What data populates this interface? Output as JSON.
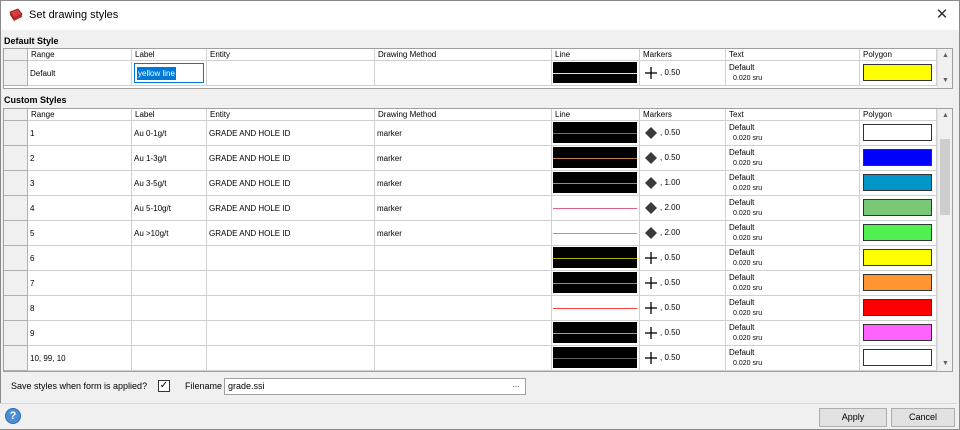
{
  "window": {
    "title": "Set drawing styles",
    "close_glyph": "✕"
  },
  "default_section": {
    "title": "Default Style"
  },
  "custom_section": {
    "title": "Custom Styles"
  },
  "columns": {
    "range": "Range",
    "label": "Label",
    "entity": "Entity",
    "drawing_method": "Drawing Method",
    "line": "Line",
    "markers": "Markers",
    "text": "Text",
    "polygon": "Polygon"
  },
  "default_row": {
    "range": "Default",
    "label": "yellow line",
    "entity": "",
    "method": "",
    "line_bg": "#000000",
    "line_color": "#ffff00",
    "marker": "cross-icon",
    "marker_size": ", 0.50",
    "text_font": "Default",
    "text_size": "0.020 sru",
    "polygon_color": "#ffff00"
  },
  "custom_rows": [
    {
      "range": "1",
      "label": "Au 0-1g/t",
      "entity": "GRADE AND HOLE ID",
      "method": "marker",
      "line_bg": "#000000",
      "line_color": "#00b050",
      "marker": "diamond-icon",
      "marker_size": ", 0.50",
      "text_font": "Default",
      "text_size": "0.020 sru",
      "polygon_color": "#ffffff"
    },
    {
      "range": "2",
      "label": "Au 1-3g/t",
      "entity": "GRADE AND HOLE ID",
      "method": "marker",
      "line_bg": "#000000",
      "line_color": "#c0804a",
      "marker": "diamond-icon",
      "marker_size": ", 0.50",
      "text_font": "Default",
      "text_size": "0.020 sru",
      "polygon_color": "#0000ff"
    },
    {
      "range": "3",
      "label": "Au 3-5g/t",
      "entity": "GRADE AND HOLE ID",
      "method": "marker",
      "line_bg": "#000000",
      "line_color": "#c0804a",
      "marker": "diamond-icon",
      "marker_size": ", 1.00",
      "text_font": "Default",
      "text_size": "0.020 sru",
      "polygon_color": "#0096c8"
    },
    {
      "range": "4",
      "label": "Au 5-10g/t",
      "entity": "GRADE AND HOLE ID",
      "method": "marker",
      "line_bg": "#ffffff",
      "line_color": "#e0608a",
      "marker": "diamond-icon",
      "marker_size": ", 2.00",
      "text_font": "Default",
      "text_size": "0.020 sru",
      "polygon_color": "#78c878"
    },
    {
      "range": "5",
      "label": "Au >10g/t",
      "entity": "GRADE AND HOLE ID",
      "method": "marker",
      "line_bg": "#ffffff",
      "line_color": "#e070d0",
      "marker": "diamond-icon",
      "marker_size": ", 2.00",
      "text_font": "Default",
      "text_size": "0.020 sru",
      "polygon_color": "#50f050"
    },
    {
      "range": "6",
      "label": "",
      "entity": "",
      "method": "",
      "line_bg": "#000000",
      "line_color": "#b0b000",
      "marker": "cross-icon",
      "marker_size": ", 0.50",
      "text_font": "Default",
      "text_size": "0.020 sru",
      "polygon_color": "#ffff00"
    },
    {
      "range": "7",
      "label": "",
      "entity": "",
      "method": "",
      "line_bg": "#000000",
      "line_color": "#c0804a",
      "marker": "cross-icon",
      "marker_size": ", 0.50",
      "text_font": "Default",
      "text_size": "0.020 sru",
      "polygon_color": "#ff9632"
    },
    {
      "range": "8",
      "label": "",
      "entity": "",
      "method": "",
      "line_bg": "#ffffff",
      "line_color": "#ff4040",
      "marker": "cross-icon",
      "marker_size": ", 0.50",
      "text_font": "Default",
      "text_size": "0.020 sru",
      "polygon_color": "#ff0000"
    },
    {
      "range": "9",
      "label": "",
      "entity": "",
      "method": "",
      "line_bg": "#000000",
      "line_color": "#e070d0",
      "marker": "cross-icon",
      "marker_size": ", 0.50",
      "text_font": "Default",
      "text_size": "0.020 sru",
      "polygon_color": "#ff64ff"
    },
    {
      "range": "10, 99, 10",
      "label": "",
      "entity": "",
      "method": "",
      "line_bg": "#000000",
      "line_color": "#606060",
      "marker": "cross-icon",
      "marker_size": ", 0.50",
      "text_font": "Default",
      "text_size": "0.020 sru",
      "polygon_color": "#ffffff"
    }
  ],
  "footer": {
    "save_label": "Save styles when form is applied?",
    "save_checked": "✓",
    "filename_label": "Filename",
    "filename_value": "grade.ssi",
    "browse_label": "..."
  },
  "buttons": {
    "help": "?",
    "apply": "Apply",
    "cancel": "Cancel"
  },
  "scrollbar": {
    "up_arrow": "▲",
    "down_arrow": "▼"
  },
  "colors": {
    "accent": "#0078d7",
    "app_icon": "#d83c3c"
  }
}
